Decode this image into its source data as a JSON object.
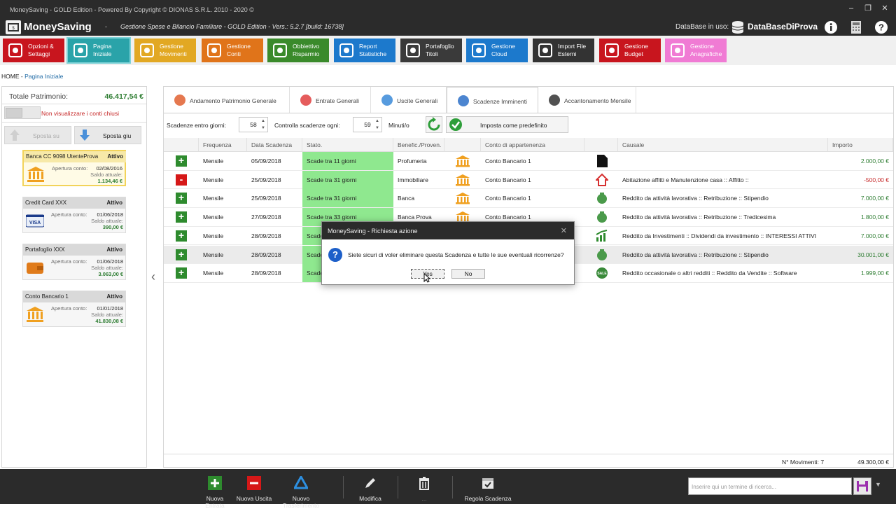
{
  "window": {
    "title": "MoneySaving - GOLD Edition  -  Powered By Copyright © DIONAS S.R.L. 2010 - 2020 ©"
  },
  "app": {
    "name": "MoneySaving",
    "dash": "-",
    "subtitle": "Gestione Spese e Bilancio Familiare - GOLD Edition - Vers.: 5.2.7 [build: 16738]",
    "db_label": "DataBase in uso:",
    "db_name": "DataBaseDiProva"
  },
  "toolbar": [
    {
      "l1": "Opzioni &",
      "l2": "Settaggi",
      "color": "#c8151e",
      "icon": "gears-icon"
    },
    {
      "l1": "Pagina",
      "l2": "Iniziale",
      "color": "#2aa3a9",
      "icon": "home-icon"
    },
    {
      "l1": "Gestione",
      "l2": "Movimenti",
      "color": "#e2a823",
      "icon": "coins-icon"
    },
    {
      "l1": "Gestione",
      "l2": "Conti",
      "color": "#e0741a",
      "icon": "money-icon"
    },
    {
      "l1": "Obbiettivo",
      "l2": "Risparmio",
      "color": "#3a8a2b",
      "icon": "safe-icon"
    },
    {
      "l1": "Report",
      "l2": "Statistiche",
      "color": "#1c79cc",
      "icon": "report-icon"
    },
    {
      "l1": "Portafoglio",
      "l2": "Titoli",
      "color": "#3a3a3a",
      "icon": "wallet-icon"
    },
    {
      "l1": "Gestione",
      "l2": "Cloud",
      "color": "#1c79cc",
      "icon": "cloud-icon"
    },
    {
      "l1": "Import File",
      "l2": "Esterni",
      "color": "#333333",
      "icon": "import-icon"
    },
    {
      "l1": "Gestione",
      "l2": "Budget",
      "color": "#c8151e",
      "icon": "chart-icon"
    },
    {
      "l1": "Gestione",
      "l2": "Anagrafiche",
      "color": "#f07bd4",
      "icon": "grid-icon"
    }
  ],
  "breadcrumb": {
    "home": "HOME",
    "sep": " - ",
    "page": "Pagina Iniziale"
  },
  "left": {
    "total_label": "Totale Patrimonio:",
    "total_value": "46.417,54 €",
    "hide_closed": "Non visualizzare i conti chiusi",
    "move_up": "Sposta su",
    "move_down": "Sposta giu",
    "accounts": [
      {
        "name": "Banca CC 9098 UtenteProva",
        "status": "Attivo",
        "open_label": "Apertura conto:",
        "open": "02/08/2016",
        "bal_label": "Saldo attuale:",
        "balance": "1.134,46 €",
        "icon": "bank-icon"
      },
      {
        "name": "Credit Card XXX",
        "status": "Attivo",
        "open_label": "Apertura conto:",
        "open": "01/06/2018",
        "bal_label": "Saldo attuale:",
        "balance": "390,00 €",
        "icon": "visa-card-icon"
      },
      {
        "name": "Portafoglio XXX",
        "status": "Attivo",
        "open_label": "Apertura conto:",
        "open": "01/06/2018",
        "bal_label": "Saldo attuale:",
        "balance": "3.063,00 €",
        "icon": "wallet-icon"
      },
      {
        "name": "Conto Bancario 1",
        "status": "Attivo",
        "open_label": "Apertura conto:",
        "open": "01/01/2018",
        "bal_label": "Saldo attuale:",
        "balance": "41.830,08 €",
        "icon": "bank-icon"
      }
    ]
  },
  "tabs": [
    "Andamento Patrimonio Generale",
    "Entrate Generali",
    "Uscite Generali",
    "Scadenze Imminenti",
    "Accantonamento Mensile"
  ],
  "controls": {
    "days_label": "Scadenze entro giorni:",
    "days": "58",
    "check_label": "Controlla scadenze ogni:",
    "check": "59",
    "minutes": "Minuti/o",
    "set_default": "Imposta come predefinito"
  },
  "table": {
    "headers": [
      "Frequenza",
      "Data Scadenza",
      "Stato.",
      "Benefic./Proven.",
      "",
      "Conto di appartenenza",
      "",
      "Causale",
      "Importo"
    ],
    "rows": [
      {
        "sign": "+",
        "freq": "Mensile",
        "date": "05/09/2018",
        "state": "Scade tra 11 giorni",
        "benef": "Profumeria",
        "account": "Conto Bancario 1",
        "cat": "document-icon",
        "causale": "",
        "amount": "2.000,00 €"
      },
      {
        "sign": "-",
        "freq": "Mensile",
        "date": "25/09/2018",
        "state": "Scade tra 31 giorni",
        "benef": "Immobiliare",
        "account": "Conto Bancario 1",
        "cat": "house-icon",
        "causale": "Abitazione affitti e Manutenzione casa :: Affitto ::",
        "amount": "-500,00 €"
      },
      {
        "sign": "+",
        "freq": "Mensile",
        "date": "25/09/2018",
        "state": "Scade tra 31 giorni",
        "benef": "Banca",
        "account": "Conto Bancario 1",
        "cat": "money-bag-icon",
        "causale": "Reddito da attività lavorativa :: Retribuzione :: Stipendio",
        "amount": "7.000,00 €"
      },
      {
        "sign": "+",
        "freq": "Mensile",
        "date": "27/09/2018",
        "state": "Scade tra 33 giorni",
        "benef": "Banca Prova",
        "account": "Conto Bancario 1",
        "cat": "money-bag-icon",
        "causale": "Reddito da attività lavorativa :: Retribuzione :: Tredicesima",
        "amount": "1.800,00 €"
      },
      {
        "sign": "+",
        "freq": "Mensile",
        "date": "28/09/2018",
        "state": "Scade tra 34 giorni",
        "benef": "",
        "account": "",
        "cat": "growth-chart-icon",
        "causale": "Reddito da Investimenti :: Dividendi da investimento :: INTERESSI ATTIVI",
        "amount": "7.000,00 €"
      },
      {
        "sign": "+",
        "freq": "Mensile",
        "date": "28/09/2018",
        "state": "Scade tra 34 giorni",
        "benef": "",
        "account": "",
        "cat": "money-bag-icon",
        "causale": "Reddito da attività lavorativa :: Retribuzione :: Stipendio",
        "amount": "30.001,00 €"
      },
      {
        "sign": "+",
        "freq": "Mensile",
        "date": "28/09/2018",
        "state": "Scade tra 34 giorni",
        "benef": "",
        "account": "",
        "cat": "sale-tag-icon",
        "causale": "Reddito occasionale o altri redditi :: Reddito da Vendite :: Software",
        "amount": "1.999,00 €"
      }
    ],
    "footer_label": "N° Movimenti: 7",
    "footer_total": "49.300,00 €"
  },
  "dialog": {
    "title": "MoneySaving - Richiesta azione",
    "message": "Siete sicuri di voler eliminare questa Scadenza e tutte le sue eventuali ricorrenze?",
    "yes": "Yes",
    "no": "No"
  },
  "bottom": {
    "nuova_entrata": "Nuova Entrata",
    "nuova_uscita": "Nuova Uscita",
    "nuovo_trasferimento": "Nuovo Trasferimento",
    "modifica": "Modifica",
    "elimina": "...",
    "regola": "Regola Scadenza",
    "search_placeholder": "Inserire qui un termine di ricerca..."
  },
  "colors": {
    "positive": "#2e7d32",
    "negative": "#c62828",
    "status_green": "#8fe88f",
    "accent_blue": "#1f6aa5"
  }
}
